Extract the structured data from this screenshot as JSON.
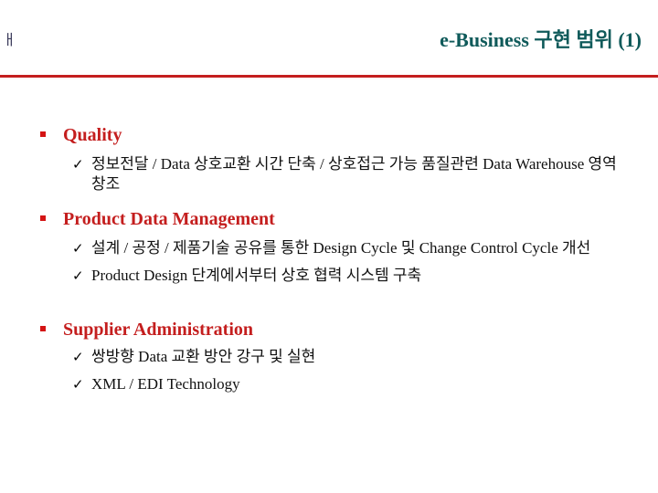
{
  "header": {
    "corner_glyph": "ㅐ",
    "title": "e-Business 구현 범위 (1)",
    "rule_color": "#c41e1e"
  },
  "sections": [
    {
      "heading": "Quality",
      "items": [
        "정보전달 / Data 상호교환 시간 단축 / 상호접근 가능 품질관련 Data Warehouse 영역 창조"
      ]
    },
    {
      "heading": "Product Data Management",
      "items": [
        "설계 / 공정 / 제품기술 공유를 통한 Design Cycle 및 Change Control Cycle 개선",
        "Product Design 단계에서부터 상호 협력 시스템 구축"
      ]
    },
    {
      "heading": "Supplier Administration",
      "items": [
        "쌍방향 Data 교환 방안 강구 및 실현",
        "XML / EDI Technology"
      ]
    }
  ],
  "icons": {
    "section_bullet": "square-bullet-icon",
    "item_bullet": "checkmark-icon"
  },
  "colors": {
    "title": "#0f5a5a",
    "heading": "#c41e1e",
    "body_text": "#111111"
  }
}
